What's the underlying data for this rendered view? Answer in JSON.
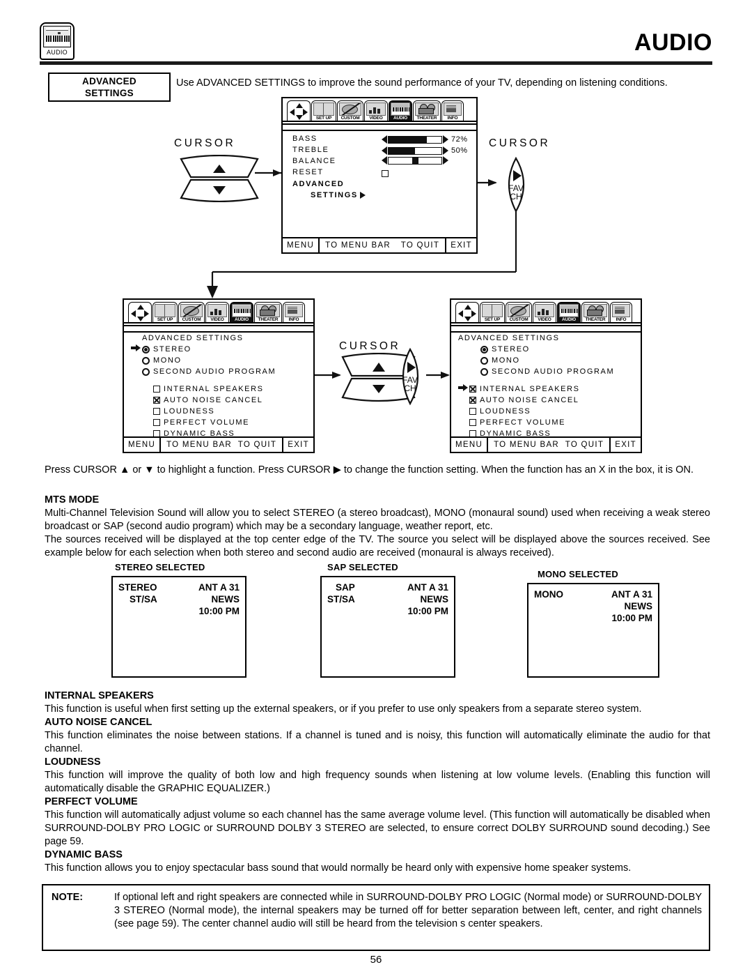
{
  "header": {
    "badge_label": "AUDIO",
    "badge_icon": "audio-keyboard-icon",
    "title": "AUDIO"
  },
  "section": {
    "label_line1": "ADVANCED",
    "label_line2": "SETTINGS",
    "intro": "Use ADVANCED SETTINGS to improve the sound performance of your TV, depending on listening conditions."
  },
  "menubar": {
    "items": [
      {
        "tag": "",
        "icon": "cursor-pad-icon",
        "selected": false
      },
      {
        "tag": "SET UP",
        "icon": "setup-icon",
        "selected": false
      },
      {
        "tag": "CUSTOM",
        "icon": "custom-palette-icon",
        "selected": false
      },
      {
        "tag": "VIDEO",
        "icon": "video-bars-icon",
        "selected": false
      },
      {
        "tag": "AUDIO",
        "icon": "audio-keyboard-icon",
        "selected": true
      },
      {
        "tag": "THEATER",
        "icon": "theater-projector-icon",
        "selected": false
      },
      {
        "tag": "INFO",
        "icon": "info-document-icon",
        "selected": false
      }
    ]
  },
  "osd_footer": {
    "menu": "MENU",
    "to_menu_bar": "TO MENU BAR",
    "to_quit": "TO QUIT",
    "exit": "EXIT"
  },
  "screen_main": {
    "rows": [
      {
        "label": "BASS",
        "type": "slider",
        "value": 72,
        "value_text": "72%"
      },
      {
        "label": "TREBLE",
        "type": "slider",
        "value": 50,
        "value_text": "50%"
      },
      {
        "label": "BALANCE",
        "type": "balance",
        "value": 50,
        "value_text": ""
      },
      {
        "label": "RESET",
        "type": "checkbox",
        "checked": false
      },
      {
        "label": "ADVANCED",
        "type": "submenu",
        "label2": "SETTINGS"
      }
    ]
  },
  "screen_left": {
    "title": "ADVANCED SETTINGS",
    "radios": [
      {
        "label": "STEREO",
        "selected": true,
        "pointer": true
      },
      {
        "label": "MONO",
        "selected": false,
        "pointer": false
      },
      {
        "label": "SECOND AUDIO PROGRAM",
        "selected": false,
        "pointer": false
      }
    ],
    "checks": [
      {
        "label": "INTERNAL SPEAKERS",
        "checked": false,
        "pointer": false
      },
      {
        "label": "AUTO NOISE CANCEL",
        "checked": true,
        "pointer": false
      },
      {
        "label": "LOUDNESS",
        "checked": false,
        "pointer": false
      },
      {
        "label": "PERFECT VOLUME",
        "checked": false,
        "pointer": false
      },
      {
        "label": "DYNAMIC BASS",
        "checked": false,
        "pointer": false
      }
    ]
  },
  "screen_right": {
    "title": "ADVANCED SETTINGS",
    "radios": [
      {
        "label": "STEREO",
        "selected": true,
        "pointer": false
      },
      {
        "label": "MONO",
        "selected": false,
        "pointer": false
      },
      {
        "label": "SECOND AUDIO PROGRAM",
        "selected": false,
        "pointer": false
      }
    ],
    "checks": [
      {
        "label": "INTERNAL SPEAKERS",
        "checked": true,
        "pointer": true
      },
      {
        "label": "AUTO NOISE CANCEL",
        "checked": true,
        "pointer": false
      },
      {
        "label": "LOUDNESS",
        "checked": false,
        "pointer": false
      },
      {
        "label": "PERFECT VOLUME",
        "checked": false,
        "pointer": false
      },
      {
        "label": "DYNAMIC BASS",
        "checked": false,
        "pointer": false
      }
    ]
  },
  "cursor_controls": {
    "label": "CURSOR",
    "fav_line1": "FAV",
    "fav_line2": "CH"
  },
  "body": {
    "press_cursor": "Press CURSOR ▲ or ▼ to highlight a function. Press CURSOR ▶ to change the function setting. When the function has an  X  in the box, it is ON.",
    "mts_heading": "MTS MODE",
    "mts_p1": "Multi-Channel Television Sound will allow you to select STEREO (a stereo broadcast), MONO (monaural sound) used when receiving a weak stereo broadcast or SAP (second audio program) which may be a secondary language, weather report, etc.",
    "mts_p2": "The sources received will be displayed at the top center edge of the TV.  The source you select will be displayed above the sources received.  See example below for each selection when both stereo and second audio are received (monaural is always received).",
    "internal_speakers_heading": "INTERNAL SPEAKERS",
    "internal_speakers_text": "This function is useful when first setting up the external speakers, or if you prefer to use only speakers from a separate stereo system.",
    "auto_noise_cancel_heading": "AUTO NOISE CANCEL",
    "auto_noise_cancel_text": "This function eliminates the noise between stations. If a channel is tuned and is noisy, this function will automatically eliminate the audio for that channel.",
    "loudness_heading": "LOUDNESS",
    "loudness_text": "This function will improve the quality of both low and high frequency sounds when listening at low volume levels. (Enabling this function will automatically disable the GRAPHIC EQUALIZER.)",
    "perfect_volume_heading": "PERFECT VOLUME",
    "perfect_volume_text": "This function will automatically adjust volume so each channel has the same average volume level. (This function will automatically be disabled when SURROUND-DOLBY PRO LOGIC or SURROUND DOLBY 3 STEREO are selected, to ensure correct DOLBY SURROUND sound decoding.) See page 59.",
    "dynamic_bass_heading": "DYNAMIC BASS",
    "dynamic_bass_text": "This function allows you to enjoy spectacular bass sound that would normally be heard only with expensive home speaker systems."
  },
  "examples": [
    {
      "caption": "STEREO SELECTED",
      "left1": "STEREO",
      "left2": "ST/SA",
      "right1": "ANT A 31",
      "right2": "NEWS",
      "right3": "10:00 PM"
    },
    {
      "caption": "SAP SELECTED",
      "left1": "SAP",
      "left2": "ST/SA",
      "right1": "ANT A 31",
      "right2": "NEWS",
      "right3": "10:00 PM"
    },
    {
      "caption": "MONO SELECTED",
      "left1": "MONO",
      "left2": "",
      "right1": "ANT A 31",
      "right2": "NEWS",
      "right3": "10:00 PM"
    }
  ],
  "note": {
    "label": "NOTE:",
    "text": "If optional left and right speakers are connected while in SURROUND-DOLBY PRO LOGIC (Normal mode) or SURROUND-DOLBY 3 STEREO (Normal mode), the internal speakers may be turned off for better separation between left, center, and right channels (see page 59). The center channel audio will still be heard from the television s center speakers."
  },
  "page_number": "56"
}
